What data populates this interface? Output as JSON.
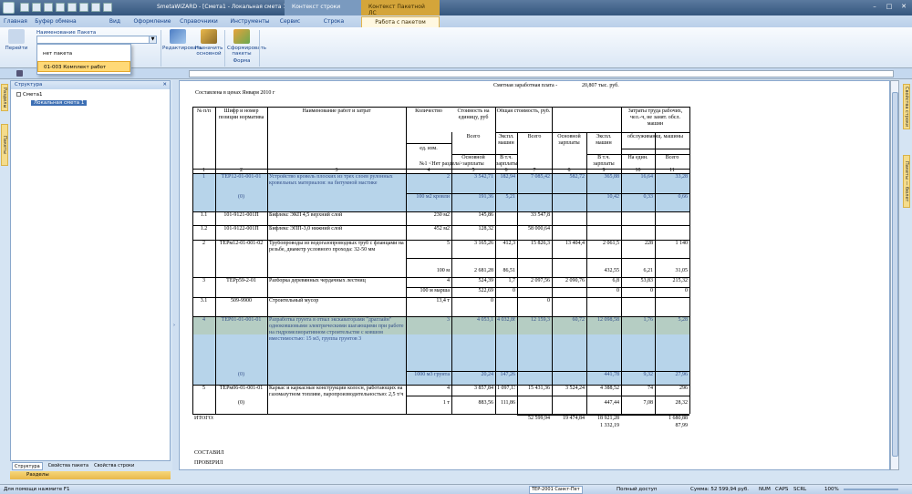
{
  "window": {
    "title": "SmetaWIZARD - [Смета1 - Локальная смета 1]",
    "context_tab_row": "Контекст строки",
    "context_tab_pkg": "Контекст Пакетной ЛС"
  },
  "tabs": [
    "Главная",
    "Буфер обмена",
    "Вид",
    "Оформление",
    "Справочники",
    "Инструменты",
    "Сервис",
    "Строка",
    "Работа с пакетом"
  ],
  "ribbon": {
    "prev_label": "Перейти",
    "pkg_label": "Наименование Пакета",
    "edit_label": "Редактировать",
    "assign_label": "Назначить основной",
    "form_label": "Сформировать пакеты",
    "group_form": "Форма"
  },
  "dropdown": {
    "items": [
      "нет пакета",
      "01-003  Комплект работ"
    ]
  },
  "left_panel": {
    "title": "Структура",
    "tree_root": "Смета1",
    "tree_child": "Локальная смета 1",
    "tabs": [
      "Структура",
      "Свойства пакета",
      "Свойства строки"
    ],
    "sections": "Разделы"
  },
  "side_tabs": {
    "left1": "Разделы",
    "left2": "Пакеты",
    "right1": "Свойства строки",
    "right2": "Пакеты — бюлет"
  },
  "doc": {
    "wage_label": "Сметная заработная плата -",
    "wage_value": "20,807 тыс. руб.",
    "compiled_line": "Составлена в ценах Января 2010 г",
    "headers": {
      "num": "№\nп/п",
      "code": "Шифр и номер позиции норматива",
      "name": "Наименование работ и затрат",
      "qty": "Количество",
      "unit_cost": "Стоимость на единицу, руб",
      "total_cost": "Общая стоимость, руб.",
      "labor": "Затраты труда рабочих, чел.-ч, не занят. обсл. машин",
      "unit": "ед. изм.",
      "all1": "Всего",
      "expl": "Экспл. машин",
      "all2": "Всего",
      "base": "Основной зарплаты",
      "expl2": "Экспл. машин",
      "serv": "обслуживающ. машины",
      "basepay": "Основной зарплаты",
      "incl": "В т.ч. зарплаты",
      "incl2": "В т.ч. зарплаты",
      "per_unit": "На един.",
      "all3": "Всего"
    },
    "colnums": [
      "1",
      "2",
      "3",
      "4",
      "5",
      "6",
      "7",
      "8",
      "9",
      "10",
      "11"
    ],
    "section_title": "№1 <Нет раздела>",
    "rows": [
      {
        "n": "1",
        "code": "ТЕР12-01-001-01",
        "name": "Устройство кровель плоских из трех слоев рулонных кровельных материалов: на битумной мастике",
        "qty": "2",
        "c5": "3 542,71",
        "c6": "182,94",
        "c7": "7 085,42",
        "c8": "582,72",
        "c9": "365,88",
        "c10": "16,64",
        "c11": "33,28"
      },
      {
        "n": "",
        "code": "(0)",
        "name": "",
        "qty": "100 м2 кровли",
        "c5": "191,36",
        "c6": "5,21",
        "c7": "",
        "c8": "",
        "c9": "10,42",
        "c10": "0,33",
        "c11": "0,66"
      },
      {
        "n": "1.1",
        "code": "101-9121-001П",
        "name": "Бифлекс ЭКП 4,5 верхний слой",
        "qty": "230 м2",
        "c5": "145,86",
        "c6": "",
        "c7": "33 547,8",
        "c8": "",
        "c9": "",
        "c10": "",
        "c11": ""
      },
      {
        "n": "1.2",
        "code": "101-9122-001П",
        "name": "Бифлекс ЭПП-3,0 нижний слой",
        "qty": "452 м2",
        "c5": "128,32",
        "c6": "",
        "c7": "58 000,64",
        "c8": "",
        "c9": "",
        "c10": "",
        "c11": ""
      },
      {
        "n": "2",
        "code": "ТЕРм12-01-001-02",
        "name": "Трубопроводы из водогазопроводных труб с фланцами на резьбе, диаметр условного прохода: 32-50 мм",
        "qty": "5",
        "c5": "3 165,26",
        "c6": "412,3",
        "c7": "15 826,3",
        "c8": "13 404,4",
        "c9": "2 061,5",
        "c10": "228",
        "c11": "1 140"
      },
      {
        "n": "",
        "code": "",
        "name": "",
        "qty": "100 м",
        "c5": "2 681,28",
        "c6": "86,51",
        "c7": "",
        "c8": "",
        "c9": "432,55",
        "c10": "6,21",
        "c11": "31,05"
      },
      {
        "n": "3",
        "code": "ТЕРр59-2-01",
        "name": "Разборка деревянных чердачных лестниц",
        "qty": "4",
        "c5": "524,39",
        "c6": "1,7",
        "c7": "2 097,56",
        "c8": "2 090,76",
        "c9": "6,8",
        "c10": "53,83",
        "c11": "215,32"
      },
      {
        "n": "",
        "code": "",
        "name": "",
        "qty": "100 м марша",
        "c5": "522,69",
        "c6": "0",
        "c7": "",
        "c8": "",
        "c9": "0",
        "c10": "0",
        "c11": "0"
      },
      {
        "n": "3.1",
        "code": "509-9900",
        "name": "Строительный мусор",
        "qty": "13,4 т",
        "c5": "0",
        "c6": "",
        "c7": "0",
        "c8": "",
        "c9": "",
        "c10": "",
        "c11": ""
      },
      {
        "n": "4",
        "code": "ТЕР01-01-001-01",
        "name": "Разработка грунта в отвал экскаваторами \"драглайн\" одноковшовыми электрическими шагающими при работе на гидромелиоративном строительстве с ковшом вместимостью: 15 м3, группа грунтов 3",
        "qty": "3",
        "c5": "4 053,1",
        "c6": "4 032,86",
        "c7": "12 159,3",
        "c8": "60,72",
        "c9": "12 098,58",
        "c10": "1,76",
        "c11": "5,28"
      },
      {
        "n": "",
        "code": "(0)",
        "name": "",
        "qty": "1000 м3 грунта",
        "c5": "20,24",
        "c6": "147,26",
        "c7": "",
        "c8": "",
        "c9": "441,78",
        "c10": "9,32",
        "c11": "27,96"
      },
      {
        "n": "5",
        "code": "ТЕРм06-01-001-01",
        "name": "Каркас и каркасные конструкции колосн, работающих на газомазутном топливе, паропроизводительностью: 2,5 т/ч",
        "qty": "4",
        "c5": "3 857,84",
        "c6": "1 097,13",
        "c7": "15 431,36",
        "c8": "3 524,24",
        "c9": "4 388,52",
        "c10": "74",
        "c11": "296"
      },
      {
        "n": "",
        "code": "(0)",
        "name": "",
        "qty": "1 т",
        "c5": "883,56",
        "c6": "111,86",
        "c7": "",
        "c8": "",
        "c9": "447,44",
        "c10": "7,08",
        "c11": "28,32"
      }
    ],
    "total": {
      "label": "ИТОГО:",
      "c7": "52 599,94",
      "c8": "19 474,84",
      "c9a": "18 921,28",
      "c9b": "1 332,19",
      "c11a": "1 680,88",
      "c11b": "87,99"
    },
    "compiled": "СОСТАВИЛ",
    "checked": "ПРОВЕРИЛ"
  },
  "status": {
    "help": "Для помощи нажмите F1",
    "db": "ТЕР-2001 Санкт-Пет",
    "access": "Полный доступ",
    "sum": "Сумма: 52 599,94 руб.",
    "num": "NUM",
    "caps": "CAPS",
    "scrl": "SCRL",
    "zoom": "100%"
  }
}
